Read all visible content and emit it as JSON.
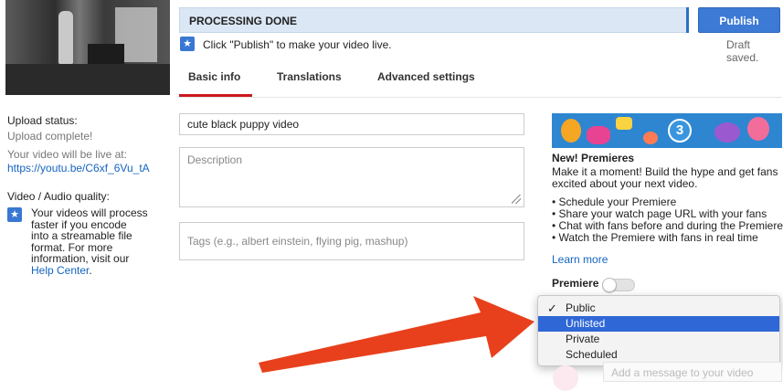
{
  "header": {
    "status_title": "PROCESSING DONE",
    "hint": "Click \"Publish\" to make your video live.",
    "publish_label": "Publish",
    "draft_status": "Draft saved."
  },
  "tabs": [
    {
      "label": "Basic info",
      "active": true
    },
    {
      "label": "Translations",
      "active": false
    },
    {
      "label": "Advanced settings",
      "active": false
    }
  ],
  "left": {
    "upload_status_label": "Upload status:",
    "upload_status_value": "Upload complete!",
    "live_at_label": "Your video will be live at:",
    "live_url": "https://youtu.be/C6xf_6Vu_tA",
    "quality_label": "Video / Audio quality:",
    "quality_text": [
      "Your videos will process",
      "faster if you encode",
      "into a streamable file",
      "format. For more",
      "information, visit our"
    ],
    "help_link": "Help Center",
    "help_suffix": "."
  },
  "form": {
    "title_value": "cute black puppy video",
    "description_placeholder": "Description",
    "tags_placeholder": "Tags (e.g., albert einstein, flying pig, mashup)"
  },
  "premieres": {
    "banner_number": "3",
    "title": "New! Premieres",
    "intro_lines": [
      "Make it a moment! Build the hype and get fans",
      "excited about your next video."
    ],
    "bullets": [
      "• Schedule your Premiere",
      "• Share your watch page URL with your fans",
      "• Chat with fans before and during the Premiere",
      "• Watch the Premiere with fans in real time"
    ],
    "learn_more": "Learn more",
    "toggle_label": "Premiere",
    "toggle_on": false
  },
  "visibility": {
    "options": [
      "Public",
      "Unlisted",
      "Private",
      "Scheduled"
    ],
    "checked": "Public",
    "highlighted": "Unlisted"
  },
  "message_placeholder": "Add a message to your video",
  "colors": {
    "accent": "#3d7ad6",
    "tab_underline": "#cc181e",
    "link": "#1565c0",
    "annotation_arrow": "#e8401c"
  }
}
